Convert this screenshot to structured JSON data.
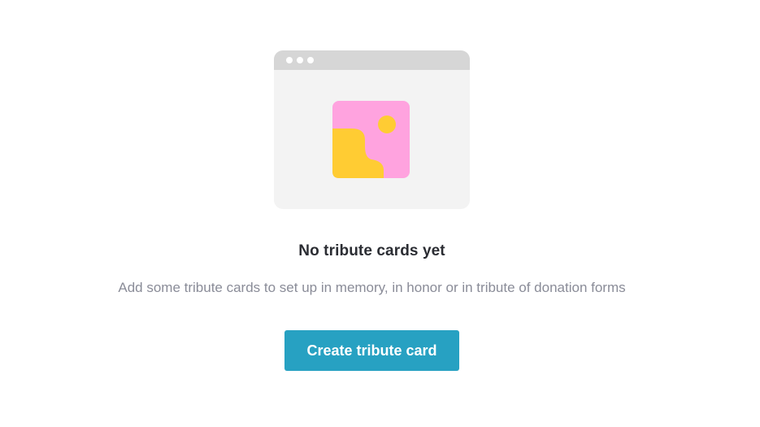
{
  "empty_state": {
    "title": "No tribute cards yet",
    "description": "Add some tribute cards to set up in memory, in honor or in tribute of donation forms",
    "button_label": "Create tribute card"
  },
  "illustration": {
    "icon": "image-placeholder-icon",
    "colors": {
      "frame": "#f3f3f3",
      "titlebar": "#d6d6d6",
      "image_background": "#ffa3df",
      "image_shapes": "#ffcc33"
    }
  },
  "colors": {
    "button": "#27a1c2",
    "title_text": "#2b2d33",
    "description_text": "#8a8c98"
  }
}
